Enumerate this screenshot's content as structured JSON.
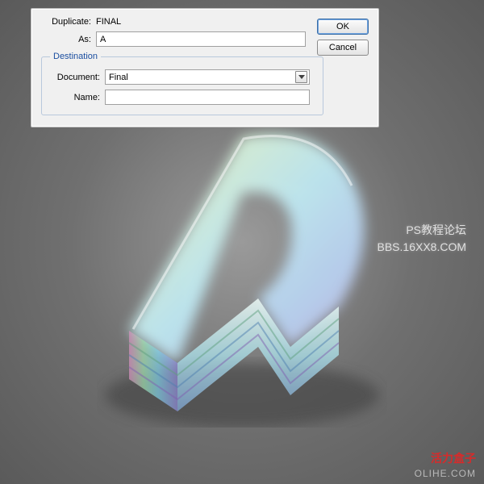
{
  "dialog": {
    "duplicate_label": "Duplicate:",
    "duplicate_value": "FINAL",
    "as_label": "As:",
    "as_value": "A",
    "destination_legend": "Destination",
    "document_label": "Document:",
    "document_value": "Final",
    "name_label": "Name:",
    "name_value": "",
    "ok_label": "OK",
    "cancel_label": "Cancel"
  },
  "watermark": {
    "line1": "PS教程论坛",
    "line2": "BBS.16XX8.COM",
    "brand": "活力盒子",
    "url": "OLIHE.COM"
  }
}
